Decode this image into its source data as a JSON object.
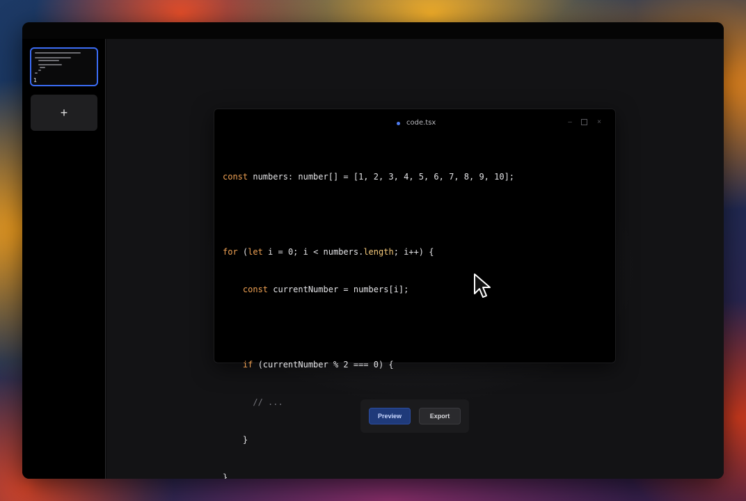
{
  "app": {
    "file": {
      "name": "code.tsx",
      "dot_color": "#4f7cf0"
    },
    "window_controls": {
      "minimize": "–",
      "close": "×"
    }
  },
  "sidebar": {
    "slides": [
      {
        "number": "1",
        "selected": true
      }
    ],
    "add_slide_label": "+"
  },
  "code": {
    "lines": [
      "const numbers: number[] = [1, 2, 3, 4, 5, 6, 7, 8, 9, 10];",
      "",
      "for (let i = 0; i < numbers.length; i++) {",
      "    const currentNumber = numbers[i];",
      "",
      "    if (currentNumber % 2 === 0) {",
      "      // ...",
      "    }",
      "}"
    ]
  },
  "toolbar": {
    "preview_label": "Preview",
    "export_label": "Export"
  },
  "colors": {
    "accent": "#3b6cf5",
    "keyword": "#f0a254",
    "property": "#f5c97a"
  }
}
